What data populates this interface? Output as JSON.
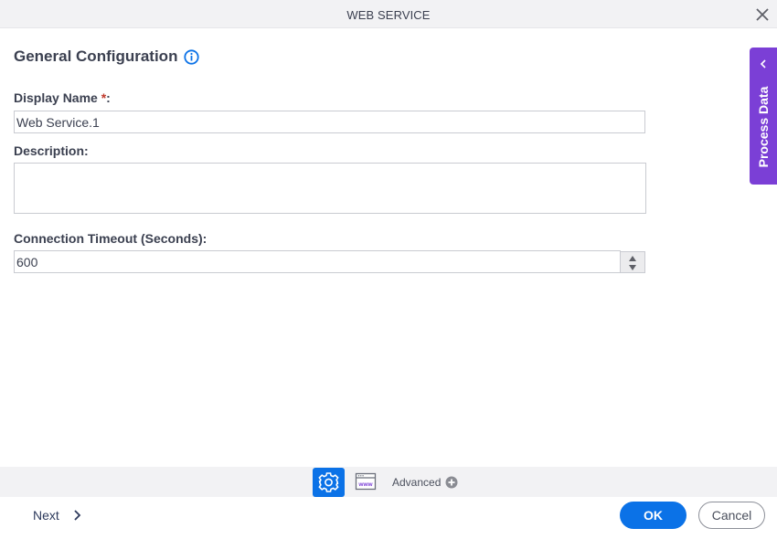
{
  "window": {
    "title": "WEB SERVICE",
    "close_icon": "close-icon"
  },
  "section": {
    "title": "General Configuration",
    "info_icon": "info-icon"
  },
  "form": {
    "display_name": {
      "label": "Display Name ",
      "required_marker": "*",
      "label_suffix": ":",
      "value": "Web Service.1"
    },
    "description": {
      "label": "Description:",
      "value": ""
    },
    "connection_timeout": {
      "label": "Connection Timeout (Seconds):",
      "value": "600"
    }
  },
  "side_panel": {
    "label": "Process Data",
    "icon": "chevron-left-icon"
  },
  "toolbar": {
    "tabs": [
      {
        "icon": "gear-icon",
        "active": true
      },
      {
        "icon": "www-icon",
        "active": false
      }
    ],
    "advanced_label": "Advanced",
    "advanced_icon": "plus-circle-icon"
  },
  "footer": {
    "next_label": "Next",
    "ok_label": "OK",
    "cancel_label": "Cancel"
  },
  "colors": {
    "primary": "#0b72e7",
    "side_panel": "#7b3fd6",
    "required": "#c0392b"
  }
}
